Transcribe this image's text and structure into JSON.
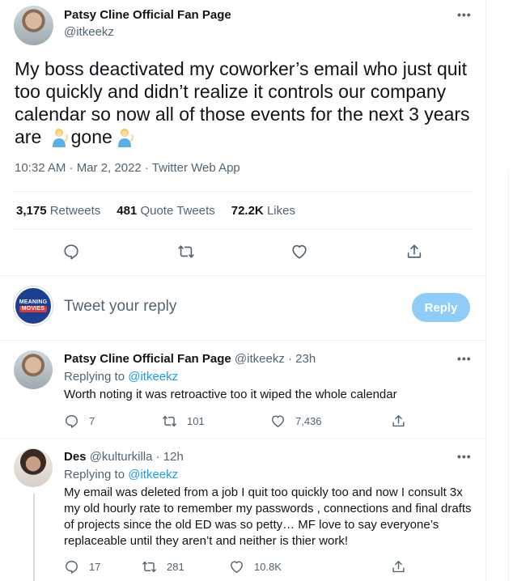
{
  "main_tweet": {
    "author_name": "Patsy Cline Official Fan Page",
    "author_handle": "@itkeekz",
    "text_part1": "My boss deactivated my coworker’s email who just quit too quickly and didn’t realize it controls our company calendar so now all of those events for the next 3 years are",
    "text_part2": "gone",
    "emoji": "person-tipping-hand-emoji",
    "timestamp": "10:32 AM · Mar 2, 2022 · Twitter Web App",
    "stats": {
      "retweets_count": "3,175",
      "retweets_label": "Retweets",
      "quotes_count": "481",
      "quotes_label": "Quote Tweets",
      "likes_count": "72.2K",
      "likes_label": "Likes"
    }
  },
  "compose": {
    "avatar_line1": "MEANING",
    "avatar_line2": "MOVIES",
    "placeholder": "Tweet your reply",
    "reply_button": "Reply"
  },
  "replies": [
    {
      "author_name": "Patsy Cline Official Fan Page",
      "author_handle": "@itkeekz",
      "time": "· 23h",
      "replying_prefix": "Replying to",
      "replying_to": "@itkeekz",
      "text": "Worth noting it was retroactive too it wiped the whole calendar",
      "replies": "7",
      "retweets": "101",
      "likes": "7,436"
    },
    {
      "author_name": "Des",
      "author_handle": "@kulturkilla",
      "time": "· 12h",
      "replying_prefix": "Replying to",
      "replying_to": "@itkeekz",
      "text": "My email was deleted from a job I quit too quickly too and now I consult 3x my old hourly rate to remember my passwords , connections and final drafts of projects since the old ED was so petty… MF love to say everyone’s replaceable until they aren’t and neither is thier work!",
      "replies": "17",
      "retweets": "281",
      "likes": "10.8K"
    }
  ],
  "colors": {
    "accent": "#1d9bf0",
    "reply_button_disabled": "#8ecdf8",
    "secondary_text": "#536471",
    "primary_text": "#0f1419",
    "divider": "#eff3f4"
  }
}
